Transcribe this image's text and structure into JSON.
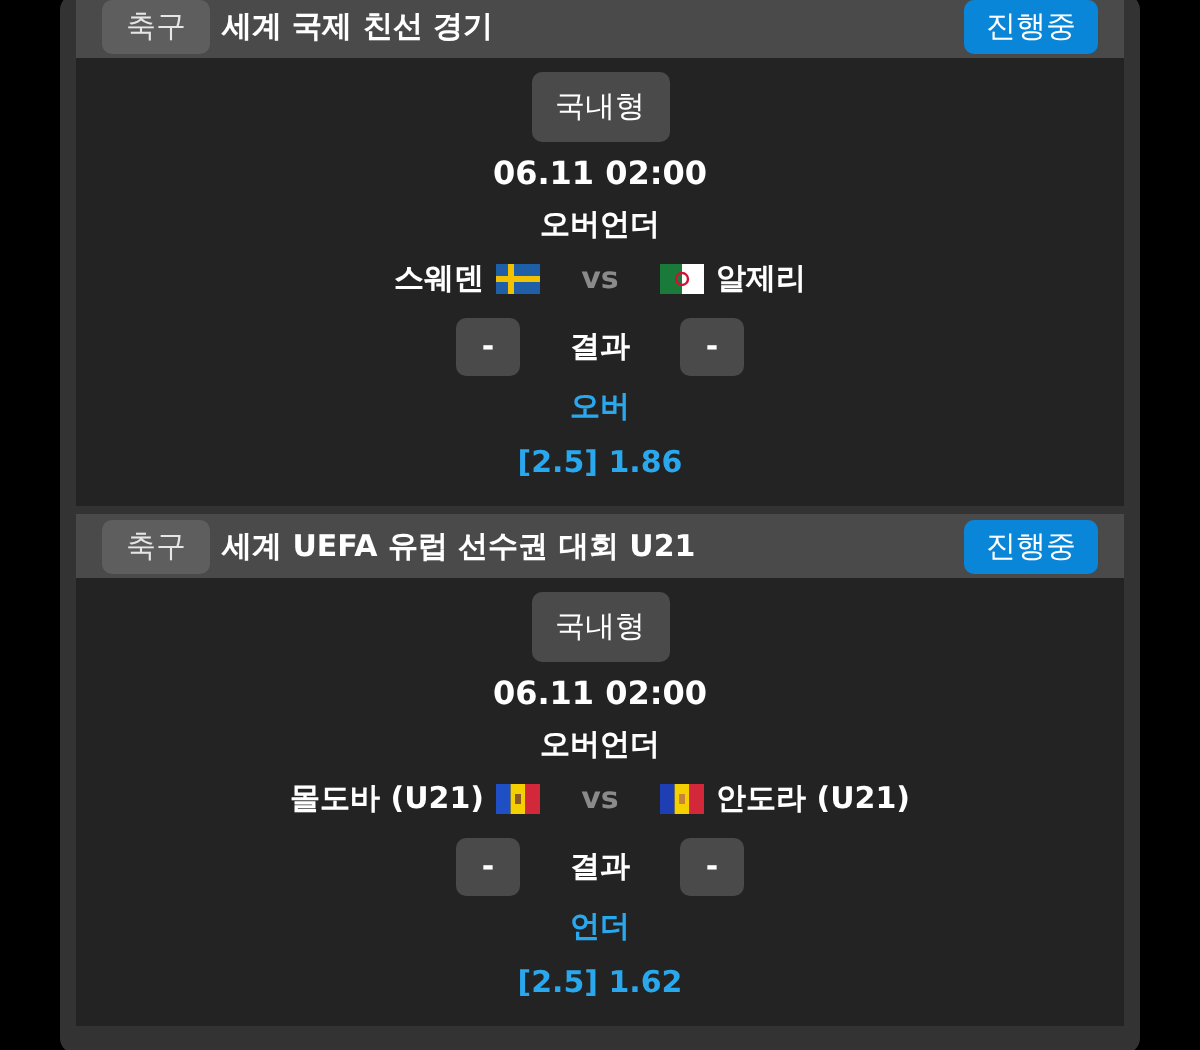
{
  "matches": [
    {
      "sport": "축구",
      "league": "세계 국제 친선 경기",
      "status": "진행중",
      "market_type": "국내형",
      "datetime": "06.11 02:00",
      "bet_type": "오버언더",
      "home": {
        "name": "스웨덴",
        "flag": {
          "kind": "sweden"
        }
      },
      "vs": "vs",
      "away": {
        "name": "알제리",
        "flag": {
          "kind": "algeria"
        }
      },
      "home_score": "-",
      "result_label": "결과",
      "away_score": "-",
      "pick": "오버",
      "odds": "[2.5] 1.86"
    },
    {
      "sport": "축구",
      "league": "세계 UEFA 유럽 선수권 대회 U21",
      "status": "진행중",
      "market_type": "국내형",
      "datetime": "06.11 02:00",
      "bet_type": "오버언더",
      "home": {
        "name": "몰도바 (U21)",
        "flag": {
          "kind": "moldova"
        }
      },
      "vs": "vs",
      "away": {
        "name": "안도라 (U21)",
        "flag": {
          "kind": "andorra"
        }
      },
      "home_score": "-",
      "result_label": "결과",
      "away_score": "-",
      "pick": "언더",
      "odds": "[2.5] 1.62"
    }
  ]
}
